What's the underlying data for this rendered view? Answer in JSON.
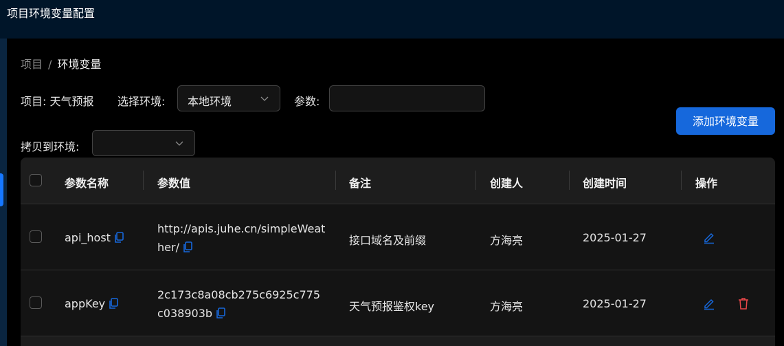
{
  "window": {
    "title": "项目环境变量配置"
  },
  "breadcrumb": {
    "parent": "项目",
    "separator": "/",
    "current": "环境变量"
  },
  "filters": {
    "project_label": "项目:",
    "project_value": "天气预报",
    "env_label": "选择环境:",
    "env_selected": "本地环境",
    "param_label": "参数:",
    "param_value": "",
    "copy_label": "拷贝到环境:",
    "copy_selected": ""
  },
  "toolbar": {
    "add_label": "添加环境变量"
  },
  "colors": {
    "accent": "#1668dc",
    "danger": "#e84749",
    "background": "#000000"
  },
  "table": {
    "columns": [
      "参数名称",
      "参数值",
      "备注",
      "创建人",
      "创建时间",
      "操作"
    ],
    "rows": [
      {
        "name": "api_host",
        "value": "http://apis.juhe.cn/simpleWeather/",
        "remark": "接口域名及前缀",
        "creator": "方海亮",
        "created": "2025-01-27",
        "actions": [
          "edit-icon"
        ]
      },
      {
        "name": "appKey",
        "value": "2c173c8a08cb275c6925c775c038903b",
        "remark": "天气预报鉴权key",
        "creator": "方海亮",
        "created": "2025-01-27",
        "actions": [
          "edit-icon",
          "trash-icon"
        ]
      }
    ]
  }
}
